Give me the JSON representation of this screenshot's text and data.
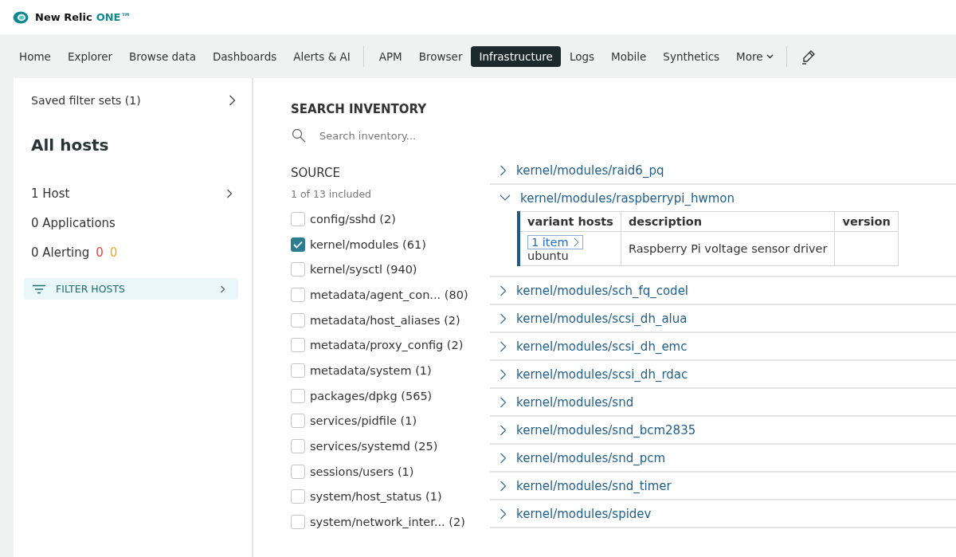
{
  "header": {
    "logo_text": "New Relic",
    "logo_accent": "ONE™"
  },
  "nav": {
    "items": [
      {
        "label": "Home",
        "kind": "link",
        "selected": false,
        "separator_after": false
      },
      {
        "label": "Explorer",
        "kind": "link",
        "selected": false,
        "separator_after": false
      },
      {
        "label": "Browse data",
        "kind": "link",
        "selected": false,
        "separator_after": false
      },
      {
        "label": "Dashboards",
        "kind": "link",
        "selected": false,
        "separator_after": false
      },
      {
        "label": "Alerts & AI",
        "kind": "link",
        "selected": false,
        "separator_after": true
      },
      {
        "label": "APM",
        "kind": "link",
        "selected": false,
        "separator_after": false
      },
      {
        "label": "Browser",
        "kind": "link",
        "selected": false,
        "separator_after": false
      },
      {
        "label": "Infrastructure",
        "kind": "link",
        "selected": true,
        "separator_after": false
      },
      {
        "label": "Logs",
        "kind": "link",
        "selected": false,
        "separator_after": false
      },
      {
        "label": "Mobile",
        "kind": "link",
        "selected": false,
        "separator_after": false
      },
      {
        "label": "Synthetics",
        "kind": "link",
        "selected": false,
        "separator_after": false
      },
      {
        "label": "More",
        "kind": "menu",
        "selected": false,
        "separator_after": true
      }
    ]
  },
  "sidebar": {
    "saved_filter_sets": "Saved filter sets (1)",
    "title": "All hosts",
    "stats": [
      {
        "label": "1 Host",
        "link": true
      },
      {
        "label": "0 Applications",
        "link": false
      },
      {
        "label": "0 Alerting",
        "link": false,
        "counts": [
          {
            "text": "0",
            "color": "#e0454e"
          },
          {
            "text": "0",
            "color": "#f5a623"
          }
        ]
      }
    ],
    "filter_button": "FILTER HOSTS"
  },
  "search": {
    "heading": "SEARCH INVENTORY",
    "placeholder": "Search inventory..."
  },
  "source": {
    "heading": "SOURCE",
    "summary": "1 of 13 included",
    "items": [
      {
        "label": "config/sshd",
        "count": "(2)",
        "checked": false
      },
      {
        "label": "kernel/modules",
        "count": "(61)",
        "checked": true
      },
      {
        "label": "kernel/sysctl",
        "count": "(940)",
        "checked": false
      },
      {
        "label": "metadata/agent_con...",
        "count": "(80)",
        "checked": false
      },
      {
        "label": "metadata/host_aliases",
        "count": "(2)",
        "checked": false
      },
      {
        "label": "metadata/proxy_config",
        "count": "(2)",
        "checked": false
      },
      {
        "label": "metadata/system",
        "count": "(1)",
        "checked": false
      },
      {
        "label": "packages/dpkg",
        "count": "(565)",
        "checked": false
      },
      {
        "label": "services/pidfile",
        "count": "(1)",
        "checked": false
      },
      {
        "label": "services/systemd",
        "count": "(25)",
        "checked": false
      },
      {
        "label": "sessions/users",
        "count": "(1)",
        "checked": false
      },
      {
        "label": "system/host_status",
        "count": "(1)",
        "checked": false
      },
      {
        "label": "system/network_inter...",
        "count": "(2)",
        "checked": false
      }
    ]
  },
  "inventory": {
    "items": [
      {
        "name": "kernel/modules/raid6_pq",
        "expanded": false
      },
      {
        "name": "kernel/modules/raspberrypi_hwmon",
        "expanded": true,
        "table": {
          "columns": [
            "variant hosts",
            "description",
            "version"
          ],
          "rows": [
            {
              "variant_link": "1 item",
              "host": "ubuntu",
              "description": "Raspberry Pi voltage sensor driver"
            }
          ]
        }
      },
      {
        "name": "kernel/modules/sch_fq_codel",
        "expanded": false
      },
      {
        "name": "kernel/modules/scsi_dh_alua",
        "expanded": false
      },
      {
        "name": "kernel/modules/scsi_dh_emc",
        "expanded": false
      },
      {
        "name": "kernel/modules/scsi_dh_rdac",
        "expanded": false
      },
      {
        "name": "kernel/modules/snd",
        "expanded": false
      },
      {
        "name": "kernel/modules/snd_bcm2835",
        "expanded": false
      },
      {
        "name": "kernel/modules/snd_pcm",
        "expanded": false
      },
      {
        "name": "kernel/modules/snd_timer",
        "expanded": false
      },
      {
        "name": "kernel/modules/spidev",
        "expanded": false
      }
    ]
  }
}
